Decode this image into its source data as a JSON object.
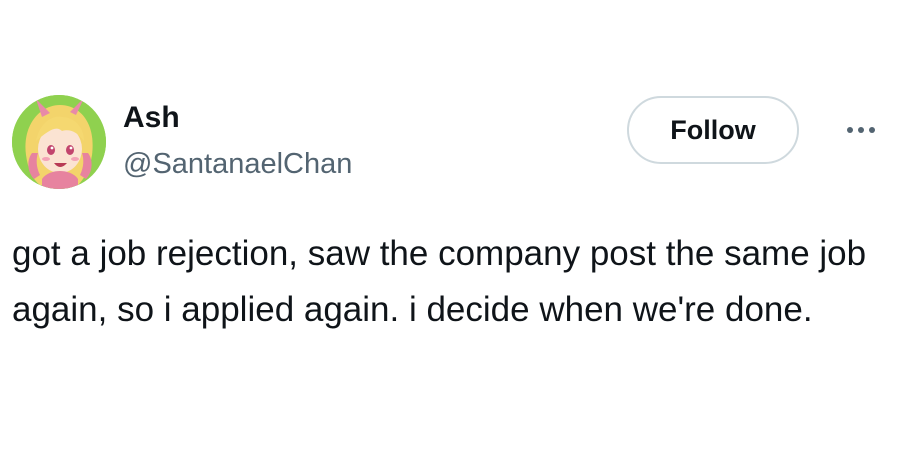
{
  "author": {
    "display_name": "Ash",
    "handle": "@SantanaelChan",
    "avatar_icon": "anime-character-avatar"
  },
  "actions": {
    "follow_label": "Follow",
    "more_icon": "more-options-icon"
  },
  "tweet": {
    "text": "got a job rejection, saw the company post the same job again, so i applied again. i decide when we're done."
  },
  "colors": {
    "text_primary": "#0f1419",
    "text_secondary": "#536471",
    "button_border": "#cfd9de",
    "avatar_background": "#8fd14f"
  }
}
